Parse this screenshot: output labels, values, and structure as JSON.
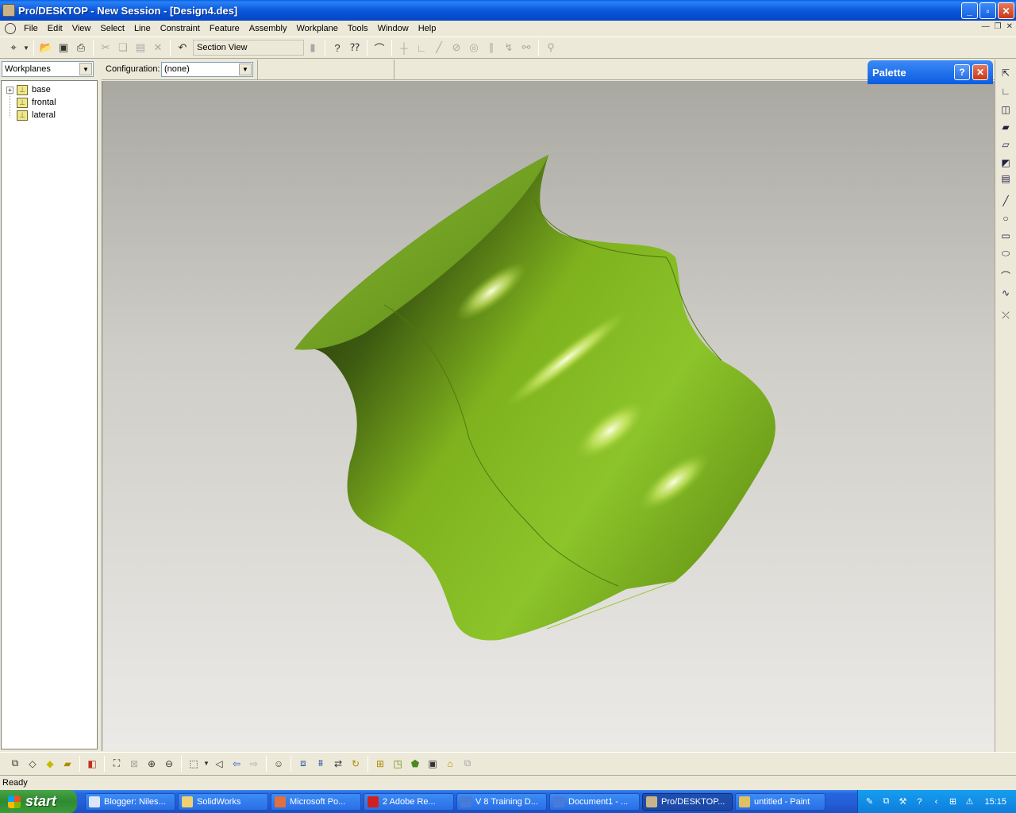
{
  "window": {
    "title": "Pro/DESKTOP - New Session - [Design4.des]"
  },
  "menu": [
    "File",
    "Edit",
    "View",
    "Select",
    "Line",
    "Constraint",
    "Feature",
    "Assembly",
    "Workplane",
    "Tools",
    "Window",
    "Help"
  ],
  "toolbar": {
    "section_view": "Section View"
  },
  "workplanes_combo": {
    "value": "Workplanes"
  },
  "configuration": {
    "label": "Configuration:",
    "value": "(none)"
  },
  "tree": {
    "items": [
      "base",
      "frontal",
      "lateral"
    ]
  },
  "palette": {
    "title": "Palette"
  },
  "status": {
    "text": "Ready"
  },
  "taskbar": {
    "start": "start",
    "tasks": [
      "Blogger: Niles...",
      "SolidWorks",
      "Microsoft Po...",
      "2 Adobe Re...",
      "V 8 Training D...",
      "Document1 - ...",
      "Pro/DESKTOP...",
      "untitled - Paint"
    ],
    "clock": "15:15"
  },
  "colors": {
    "model_green": "#7fb21e",
    "title_blue": "#0a58dc"
  }
}
